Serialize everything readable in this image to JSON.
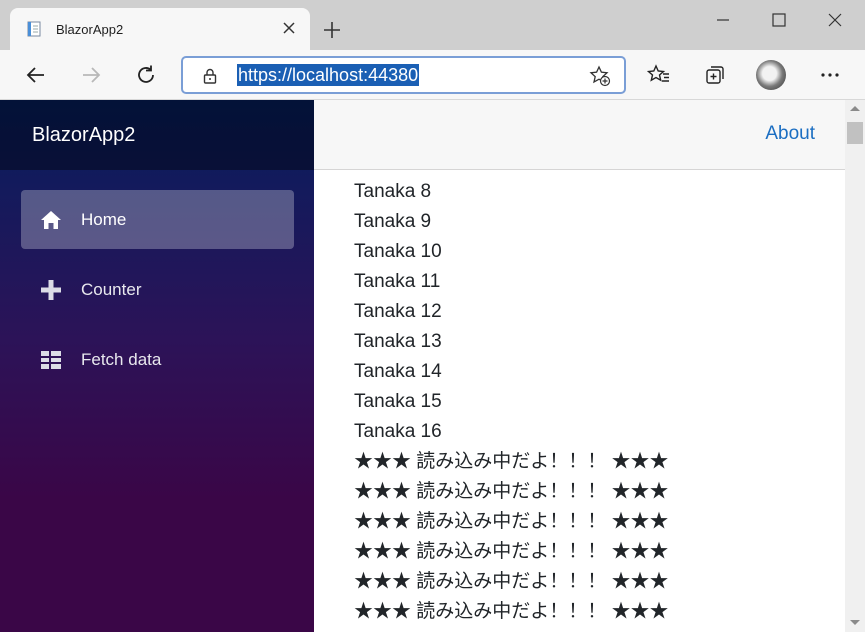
{
  "browser": {
    "tab_title": "BlazorApp2",
    "url": "https://localhost:44380",
    "icons": [
      "page-favicon",
      "close-icon",
      "plus-icon",
      "minimize-icon",
      "maximize-icon",
      "close-window-icon",
      "back-arrow-icon",
      "forward-arrow-icon",
      "refresh-icon",
      "lock-icon",
      "add-favorite-icon",
      "favorites-icon",
      "collections-icon",
      "profile-avatar",
      "more-icon"
    ]
  },
  "sidebar": {
    "brand": "BlazorApp2",
    "items": [
      {
        "label": "Home",
        "icon": "home-icon",
        "active": true
      },
      {
        "label": "Counter",
        "icon": "plus-icon",
        "active": false
      },
      {
        "label": "Fetch data",
        "icon": "list-icon",
        "active": false
      }
    ]
  },
  "header": {
    "about": "About"
  },
  "content": {
    "lines": [
      "Tanaka 8",
      "Tanaka 9",
      "Tanaka 10",
      "Tanaka 11",
      "Tanaka 12",
      "Tanaka 13",
      "Tanaka 14",
      "Tanaka 15",
      "Tanaka 16",
      "★★★ 読み込み中だよ！！！ ★★★",
      "★★★ 読み込み中だよ！！！ ★★★",
      "★★★ 読み込み中だよ！！！ ★★★",
      "★★★ 読み込み中だよ！！！ ★★★",
      "★★★ 読み込み中だよ！！！ ★★★",
      "★★★ 読み込み中だよ！！！ ★★★"
    ]
  },
  "colors": {
    "link": "#1b6ec2",
    "sidebar_top": "#051e5e",
    "sidebar_bottom": "#3a0647",
    "url_highlight": "#1a5fb4"
  }
}
